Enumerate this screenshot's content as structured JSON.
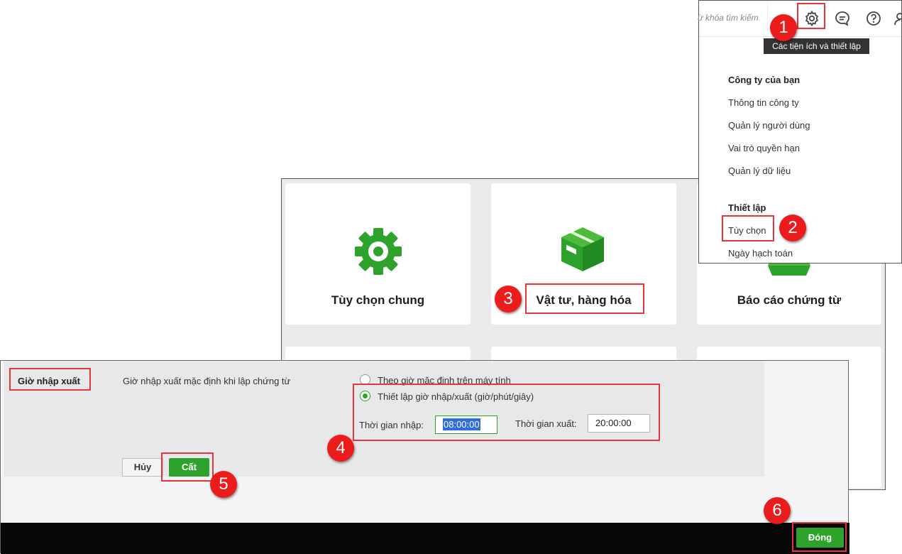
{
  "header": {
    "search_placeholder": "ừ khóa tìm kiếm",
    "icons": [
      "gear-icon",
      "chat-icon",
      "help-icon",
      "user-icon"
    ],
    "tooltip": "Các tiện ích và thiết lập"
  },
  "menu": {
    "section1_title": "Công ty của bạn",
    "section1_items": [
      "Thông tin công ty",
      "Quản lý người dùng",
      "Vai trò quyền hạn",
      "Quản lý dữ liệu"
    ],
    "section2_title": "Thiết lập",
    "section2_items": [
      "Tùy chọn",
      "Ngày hạch toán"
    ]
  },
  "settings_cards": [
    {
      "title": "Tùy chọn chung",
      "icon": "gear-icon"
    },
    {
      "title": "Vật tư, hàng hóa",
      "icon": "box-icon"
    },
    {
      "title": "Báo cáo chứng từ",
      "icon": "report-icon"
    }
  ],
  "dialog": {
    "section_label": "Giờ nhập xuất",
    "description": "Giờ nhập xuất mặc định khi lập chứng từ",
    "radio_default": "Theo giờ mặc định trên máy tính",
    "radio_custom": "Thiết lập giờ nhập/xuất (giờ/phút/giây)",
    "selected_option": "custom",
    "import_time_label": "Thời gian nhập:",
    "import_time_value": "08:00:00",
    "export_time_label": "Thời gian xuất:",
    "export_time_value": "20:00:00",
    "cancel_label": "Hủy",
    "save_label": "Cất",
    "close_label": "Đóng"
  },
  "annotations": [
    "1",
    "2",
    "3",
    "4",
    "5",
    "6"
  ],
  "colors": {
    "accent_green": "#2ea32b",
    "highlight_red": "#e8343d",
    "badge_red": "#ea1c1c",
    "selection_blue": "#2e6ed8"
  }
}
